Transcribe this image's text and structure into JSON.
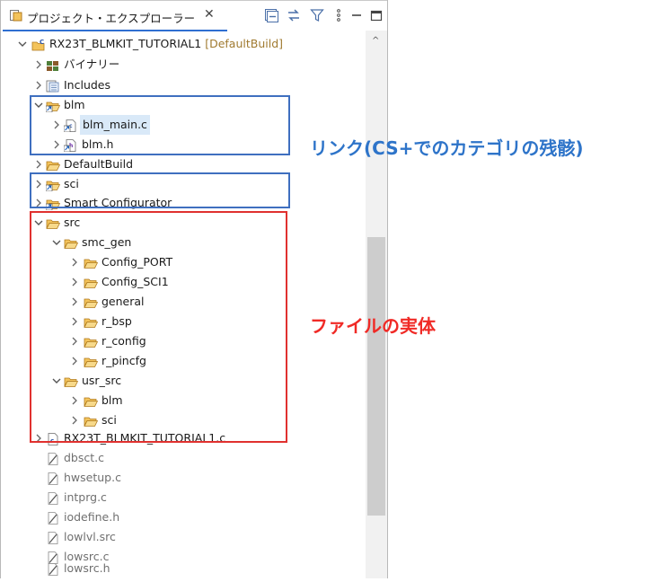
{
  "tab": {
    "title": "プロジェクト・エクスプローラー",
    "close_glyph": "✕"
  },
  "toolbar": {
    "icons": [
      "collapse-all-icon",
      "link-with-editor-icon",
      "filter-icon",
      "view-menu-icon",
      "minimize-icon",
      "maximize-icon"
    ]
  },
  "tree": {
    "project": {
      "name": "RX23T_BLMKIT_TUTORIAL1",
      "config": " [DefaultBuild]"
    },
    "binaries": "バイナリー",
    "includes": "Includes",
    "blm": "blm",
    "blm_main": "blm_main.c",
    "blm_h": "blm.h",
    "defaultbuild": "DefaultBuild",
    "sci": "sci",
    "smart_config": "Smart Configurator",
    "src": "src",
    "smc_gen": "smc_gen",
    "config_port": "Config_PORT",
    "config_sci1": "Config_SCI1",
    "general": "general",
    "r_bsp": "r_bsp",
    "r_config": "r_config",
    "r_pincfg": "r_pincfg",
    "usr_src": "usr_src",
    "usr_blm": "blm",
    "usr_sci": "sci",
    "main_c": "RX23T_BLMKIT_TUTORIAL1.c",
    "dbsct": "dbsct.c",
    "hwsetup": "hwsetup.c",
    "intprg": "intprg.c",
    "iodefine": "iodefine.h",
    "lowlvl": "lowlvl.src",
    "lowsrc_c": "lowsrc.c",
    "lowsrc_h": "lowsrc.h"
  },
  "annotations": {
    "link_note": "リンク(CS+でのカテゴリの残骸)",
    "real_note": "ファイルの実体"
  },
  "colors": {
    "blue_box": "#3f6fbf",
    "red_box": "#e0312f",
    "blue_text": "#2e74c9",
    "red_text": "#f02a26",
    "folder": "#e8a33a"
  }
}
